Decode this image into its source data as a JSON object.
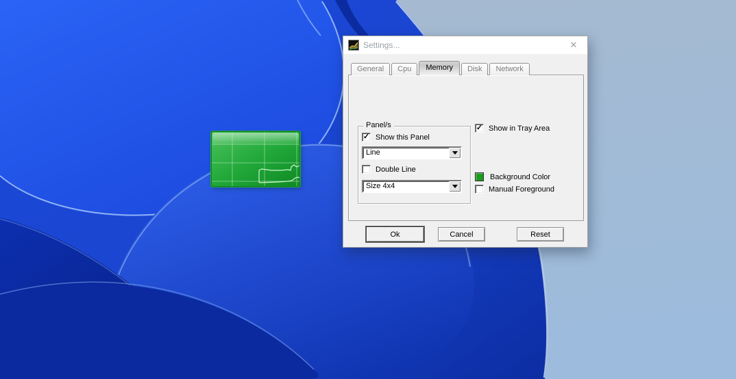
{
  "desktop": {
    "widget": {
      "label": "memory-usage-panel",
      "panel_style": "Line",
      "panel_size": "4x4",
      "background_color": "#1fa32e"
    }
  },
  "dialog": {
    "title": "Settings...",
    "close_glyph": "✕",
    "tabs": [
      {
        "label": "General"
      },
      {
        "label": "Cpu"
      },
      {
        "label": "Memory"
      },
      {
        "label": "Disk"
      },
      {
        "label": "Network"
      }
    ],
    "active_tab": "Memory",
    "panel_group": {
      "title": "Panel/s",
      "show_this_panel_label": "Show this Panel",
      "show_this_panel_check": "✓",
      "style_value": "Line",
      "double_line_label": "Double Line",
      "double_line_check": "",
      "size_value": "Size 4x4"
    },
    "options": {
      "tray_label": "Show in Tray Area",
      "tray_check": "✓",
      "background_color_label": "Background Color",
      "background_color_value": "#1e9b1e",
      "swatch_style": "background:#1e9b1e",
      "manual_foreground_label": "Manual Foreground",
      "manual_foreground_check": ""
    },
    "buttons": {
      "ok": "Ok",
      "cancel": "Cancel",
      "reset": "Reset"
    }
  }
}
